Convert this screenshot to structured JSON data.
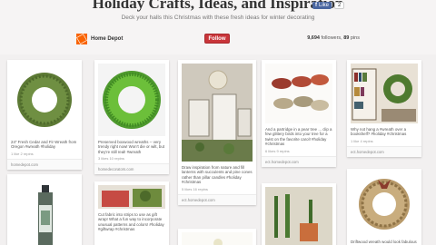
{
  "board": {
    "title": "Holiday Crafts, Ideas, and Inspiration",
    "description": "Deck your halls this Christmas with these fresh ideas for winter decorating",
    "facebook": {
      "like_label": "Like",
      "count": "2"
    }
  },
  "owner": {
    "logo_text": "THE HOME DEPOT",
    "name": "Home Depot",
    "follow_label": "Follow",
    "followers_count": "9,694",
    "followers_label": "followers,",
    "pins_count": "89",
    "pins_label": "pins"
  },
  "pins": [
    {
      "desc": "24\" Fresh Cedar and Fir Wreath from Oregon #wreath #holiday",
      "stats": "1 like   2 repins",
      "source": "homedepot.com"
    },
    {
      "desc": "Preserved boxwood wreaths -- very trendy right now! Won't die or wilt, but they're still real! #wreath",
      "stats": "3 likes   10 repins",
      "source": "homedecorators.com"
    },
    {
      "desc": "Draw inspiration from nature and fill lanterns with succulents and pine cones rather than pillar candles #holiday #christmas",
      "stats": "5 likes   16 repins",
      "source": "ect.homedepot.com"
    },
    {
      "desc": "And a partridge in a pear tree ... clip a few glittery birds into your tree for a twist on the favorite carol! #holiday #christmas",
      "stats": "6 likes   9 repins",
      "source": "ect.homedepot.com"
    },
    {
      "desc": "Why not hang a #wreath over a bookshelf? #holiday #christmas",
      "stats": "1 like   4 repins",
      "source": "ect.homedepot.com"
    },
    {
      "desc": "Cut fabric into strips to use as gift wrap! What a fun way to incorporate unusual patterns and colors! #holiday #giftwrap #christmas",
      "stats": "",
      "source": ""
    },
    {
      "desc": "Driftwood wreath would look fabulous",
      "stats": "",
      "source": ""
    }
  ]
}
